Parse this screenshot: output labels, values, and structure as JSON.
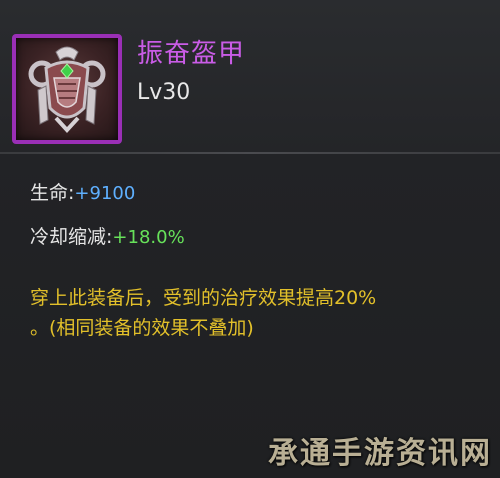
{
  "item": {
    "name": "振奋盔甲",
    "level": "Lv30",
    "icon": "armor-icon"
  },
  "stats": [
    {
      "label": "生命:",
      "value": "+9100",
      "color": "#5fb0ff"
    },
    {
      "label": "冷却缩减:",
      "value": "+18.0%",
      "color": "#67e25a"
    }
  ],
  "description": {
    "line1": "穿上此装备后，受到的治疗效果提高20%",
    "line2": "。(相同装备的效果不叠加)"
  },
  "watermark": "承通手游资讯网",
  "colors": {
    "rarity_purple": "#9a2fb6",
    "title": "#c95ce6",
    "desc": "#e2c02a"
  }
}
